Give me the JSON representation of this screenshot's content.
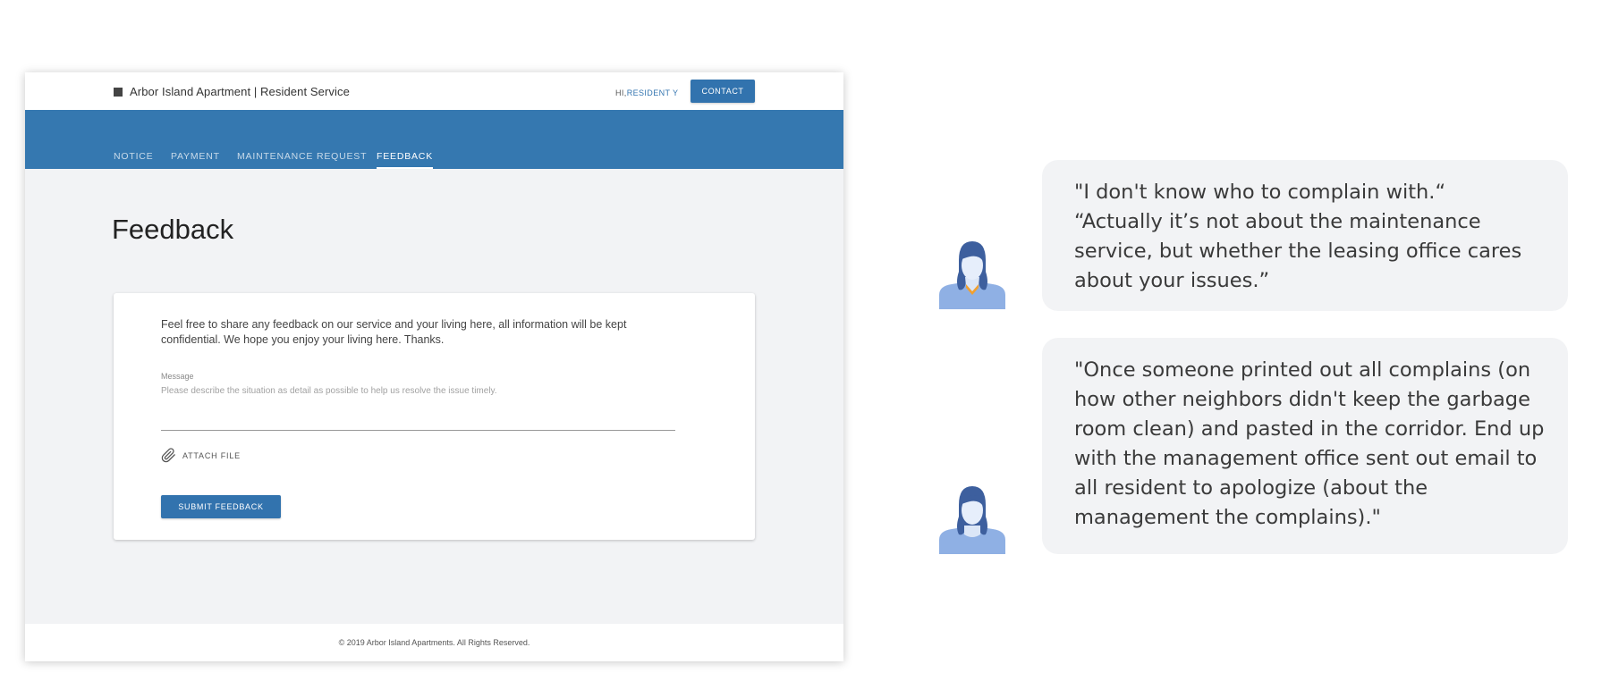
{
  "app": {
    "brand": "Arbor Island Apartment | Resident Service",
    "greeting_prefix": "HI,",
    "greeting_name": "RESIDENT Y",
    "contact_label": "CONTACT"
  },
  "nav": {
    "tabs": [
      {
        "label": "NOTICE",
        "active": false
      },
      {
        "label": "PAYMENT",
        "active": false
      },
      {
        "label": "MAINTENANCE REQUEST",
        "active": false
      },
      {
        "label": "FEEDBACK",
        "active": true
      }
    ]
  },
  "main": {
    "title": "Feedback",
    "intro": "Feel free to share any feedback on our service and your living here, all information will be kept confidential. We hope you enjoy your living here. Thanks.",
    "message_label": "Message",
    "message_placeholder": "Please describe the situation as detail as possible to help us resolve the issue timely.",
    "message_value": "",
    "attach_label": "ATTACH FILE",
    "submit_label": "SUBMIT FEEDBACK"
  },
  "footer": {
    "copyright": "© 2019 Arbor Island Apartments. All Rights Reserved."
  },
  "quotes": [
    {
      "avatar_icon": "woman-avatar-icon",
      "lines": [
        "\"I don't know who to complain with.“",
        "“Actually it’s not about the maintenance service, but whether the leasing office cares about your issues.”"
      ]
    },
    {
      "avatar_icon": "woman-avatar-icon",
      "lines": [
        "\"Once someone printed out all complains (on how other neighbors didn't keep the garbage room clean) and pasted in the corridor. End up with the management office sent out email to all resident to apologize (about the management the complains).\""
      ]
    }
  ],
  "colors": {
    "primary": "#3578b0",
    "button": "#3273ae",
    "page_bg": "#f2f3f5",
    "bubble_bg": "#f2f3f5",
    "avatar_hair": "#3d5f9e",
    "avatar_body": "#8fb0e4",
    "collar": "#f0a030"
  }
}
